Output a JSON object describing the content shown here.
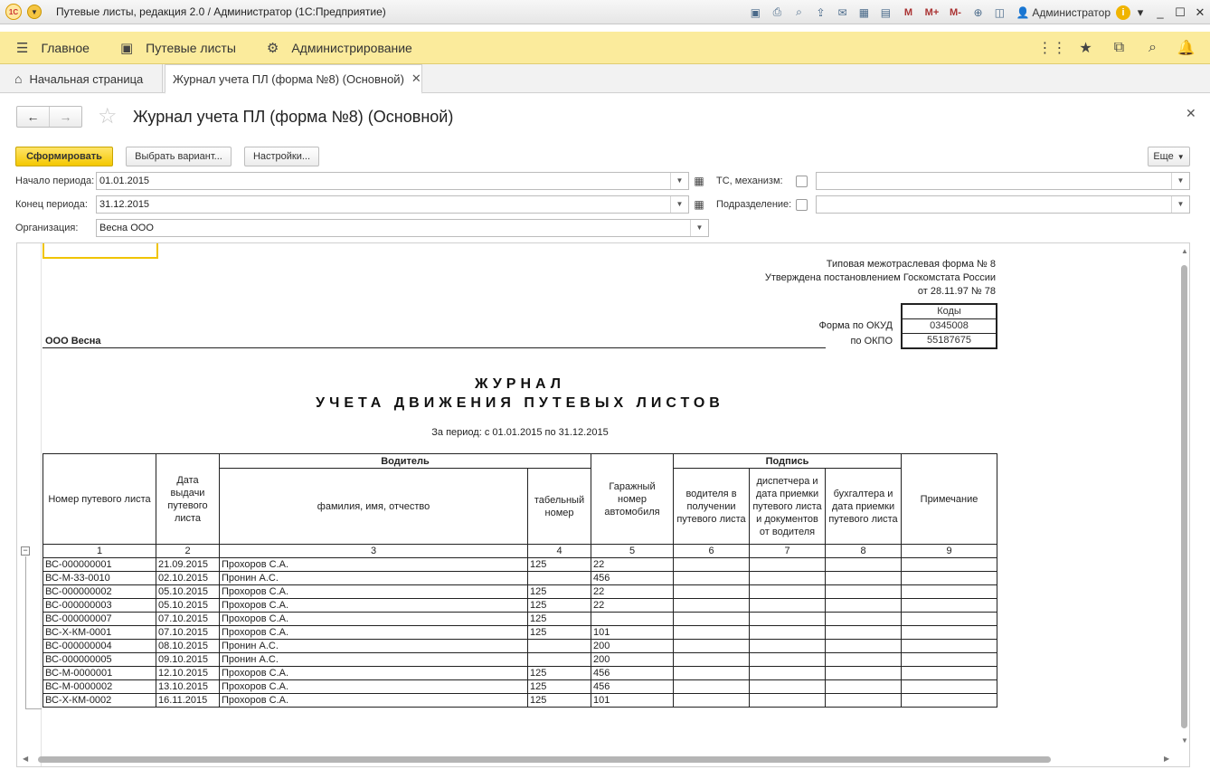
{
  "window": {
    "title": "Путевые листы, редакция 2.0 / Администратор  (1С:Предприятие)",
    "user": "Администратор",
    "memory_buttons": [
      "M",
      "M+",
      "M-"
    ]
  },
  "sections": [
    {
      "label": "Главное",
      "icon": "menu-icon"
    },
    {
      "label": "Путевые листы",
      "icon": "waybill-icon"
    },
    {
      "label": "Администрирование",
      "icon": "gear-icon"
    }
  ],
  "tabs": {
    "home": "Начальная страница",
    "active": "Журнал учета ПЛ (форма №8) (Основной)"
  },
  "form": {
    "title": "Журнал учета ПЛ (форма №8) (Основной)",
    "buttons": {
      "generate": "Сформировать",
      "variant": "Выбрать вариант...",
      "settings": "Настройки...",
      "more": "Еще"
    },
    "fields": {
      "period_start_label": "Начало периода:",
      "period_start": "01.01.2015",
      "period_end_label": "Конец периода:",
      "period_end": "31.12.2015",
      "org_label": "Организация:",
      "org": "Весна ООО",
      "vehicle_label": "ТС, механизм:",
      "vehicle": "",
      "dept_label": "Подразделение:",
      "dept": ""
    }
  },
  "report": {
    "form_note": [
      "Типовая межотраслевая форма № 8",
      "Утверждена постановлением Госкомстата России",
      "от 28.11.97 № 78"
    ],
    "codes_header": "Коды",
    "okud_label": "Форма по ОКУД",
    "okud": "0345008",
    "okpo_label": "по ОКПО",
    "okpo": "55187675",
    "org_name": "ООО Весна",
    "title1": "ЖУРНАЛ",
    "title2": "УЧЕТА ДВИЖЕНИЯ ПУТЕВЫХ ЛИСТОВ",
    "period": "За период: с 01.01.2015  по  31.12.2015",
    "headers": {
      "col1": "Номер путевого листа",
      "col2": "Дата выдачи путевого листа",
      "driver_group": "Водитель",
      "col3": "фамилия, имя, отчество",
      "col4": "табельный номер",
      "col5": "Гаражный номер автомобиля",
      "sign_group": "Подпись",
      "col6": "водителя в получении путевого листа",
      "col7": "диспетчера и дата приемки путевого листа и документов от водителя",
      "col8": "бухгалтера и дата приемки путевого листа",
      "col9": "Примечание"
    },
    "col_numbers": [
      "1",
      "2",
      "3",
      "4",
      "5",
      "6",
      "7",
      "8",
      "9"
    ],
    "rows": [
      [
        "ВС-000000001",
        "21.09.2015",
        "Прохоров С.А.",
        "125",
        "22"
      ],
      [
        "ВС-М-33-0010",
        "02.10.2015",
        "Пронин А.С.",
        "",
        "456"
      ],
      [
        "ВС-000000002",
        "05.10.2015",
        "Прохоров С.А.",
        "125",
        "22"
      ],
      [
        "ВС-000000003",
        "05.10.2015",
        "Прохоров С.А.",
        "125",
        "22"
      ],
      [
        "ВС-000000007",
        "07.10.2015",
        "Прохоров С.А.",
        "125",
        ""
      ],
      [
        "ВС-Х-КМ-0001",
        "07.10.2015",
        "Прохоров С.А.",
        "125",
        "101"
      ],
      [
        "ВС-000000004",
        "08.10.2015",
        "Пронин А.С.",
        "",
        "200"
      ],
      [
        "ВС-000000005",
        "09.10.2015",
        "Пронин А.С.",
        "",
        "200"
      ],
      [
        "ВС-М-0000001",
        "12.10.2015",
        "Прохоров С.А.",
        "125",
        "456"
      ],
      [
        "ВС-М-0000002",
        "13.10.2015",
        "Прохоров С.А.",
        "125",
        "456"
      ],
      [
        "ВС-Х-КМ-0002",
        "16.11.2015",
        "Прохоров С.А.",
        "125",
        "101"
      ]
    ]
  }
}
